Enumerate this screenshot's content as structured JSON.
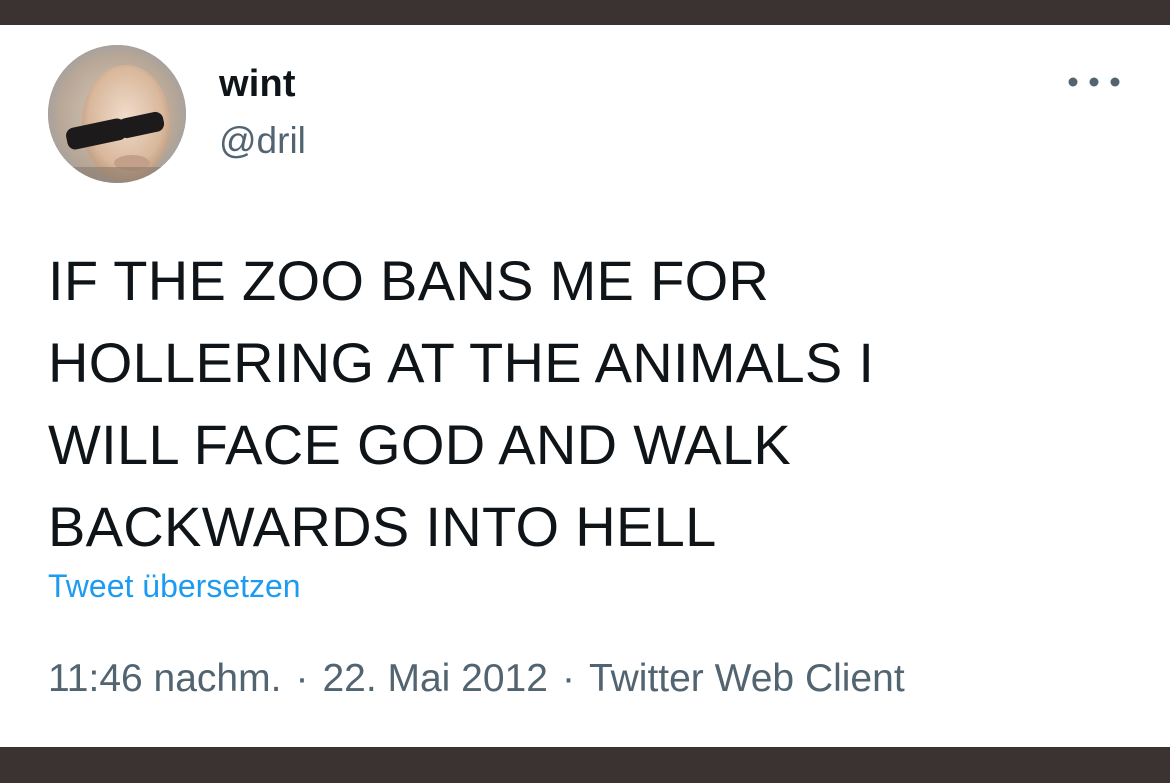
{
  "tweet": {
    "author": {
      "display_name": "wint",
      "handle": "@dril",
      "avatar_icon": "profile-avatar"
    },
    "more_icon": "more-dots-icon",
    "text": "IF THE ZOO BANS ME FOR\nHOLLERING AT THE ANIMALS I\nWILL FACE GOD AND WALK\nBACKWARDS INTO HELL",
    "translate_label": "Tweet übersetzen",
    "time": "11:46 nachm.",
    "separator": "·",
    "date": "22. Mai 2012",
    "source": "Twitter Web Client"
  },
  "colors": {
    "text_primary": "#0f1419",
    "text_secondary": "#536471",
    "link": "#1d9bf0",
    "frame": "#3a3331",
    "background": "#ffffff"
  }
}
